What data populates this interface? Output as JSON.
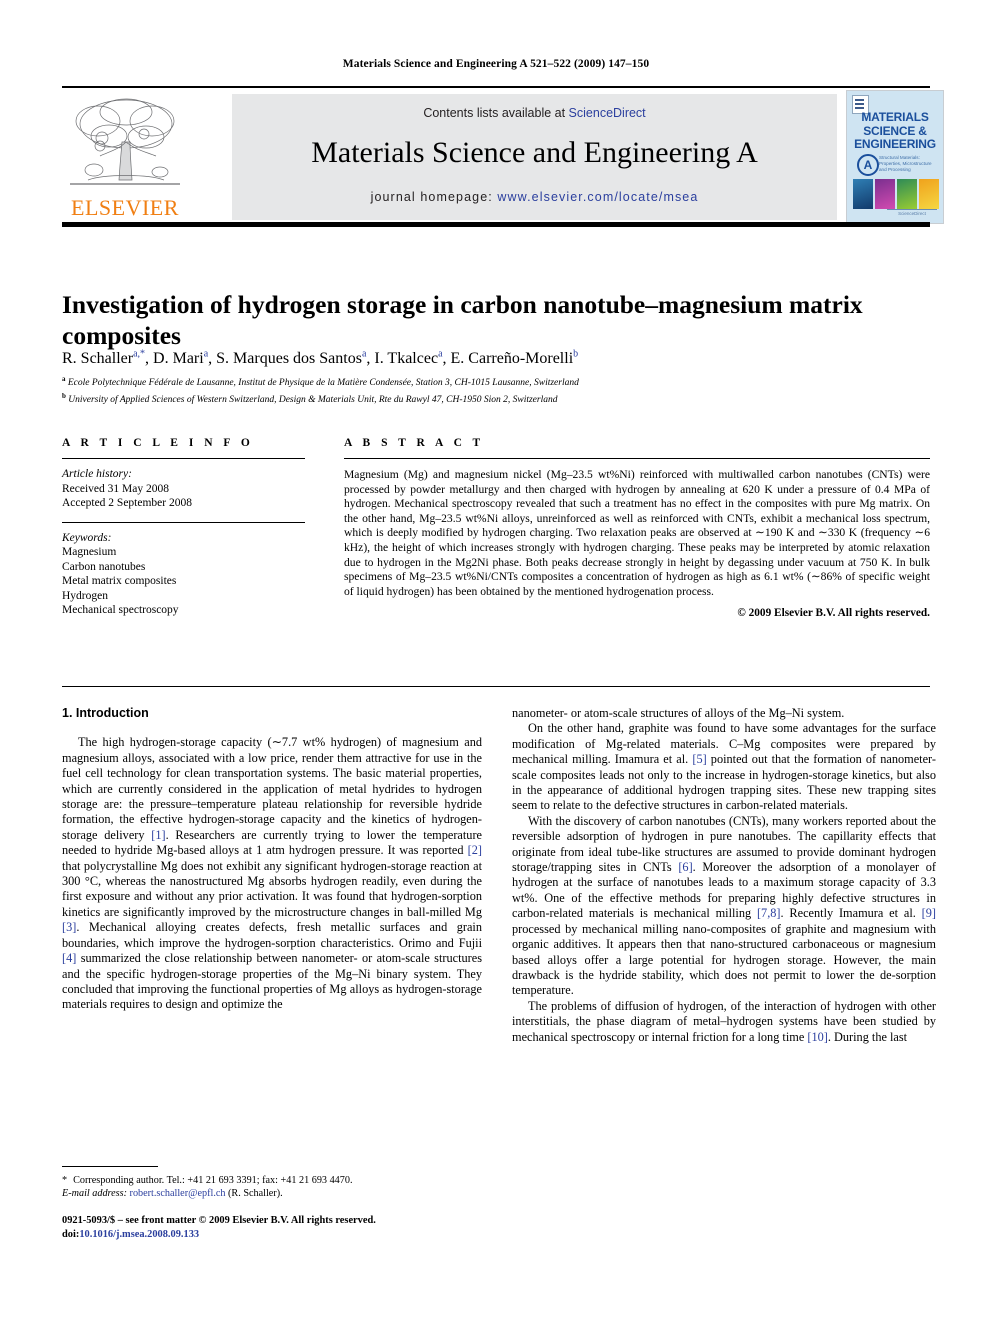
{
  "running_head": "Materials Science and Engineering A 521–522 (2009) 147–150",
  "masthead": {
    "contents_prefix": "Contents lists available at ",
    "sciencedirect": "ScienceDirect",
    "journal_title": "Materials Science and Engineering A",
    "homepage_prefix": "journal homepage: ",
    "homepage_url": "www.elsevier.com/locate/msea",
    "publisher": "ELSEVIER",
    "publisher_icon": "elsevier-tree-icon",
    "cover": {
      "title_line1": "MATERIALS",
      "title_line2": "SCIENCE &",
      "title_line3": "ENGINEERING",
      "badge": "A",
      "subtitle": "Structural Materials: Properties, Microstructure and Processing",
      "footer": "ScienceDirect",
      "background": "#cfe4f2",
      "title_color": "#1b4f9c"
    },
    "link_color": "#2b3f9e",
    "elsevier_orange": "#F07F13"
  },
  "article": {
    "title": "Investigation of hydrogen storage in carbon nanotube–magnesium matrix composites",
    "authors": "R. Schaller, D. Mari, S. Marques dos Santos, I. Tkalcec, E. Carreño-Morelli",
    "affiliation_a": "Ecole Polytechnique Fédérale de Lausanne, Institut de Physique de la Matière Condensée, Station 3, CH-1015 Lausanne, Switzerland",
    "affiliation_b": "University of Applied Sciences of Western Switzerland, Design & Materials Unit, Rte du Rawyl 47, CH-1950 Sion 2, Switzerland"
  },
  "article_info": {
    "heading": "A R T I C L E    I N F O",
    "history_label": "Article history:",
    "received": "Received 31 May 2008",
    "accepted": "Accepted 2 September 2008",
    "keywords_label": "Keywords:",
    "keywords": [
      "Magnesium",
      "Carbon nanotubes",
      "Metal matrix composites",
      "Hydrogen",
      "Mechanical spectroscopy"
    ]
  },
  "abstract": {
    "heading": "A B S T R A C T",
    "text": "Magnesium (Mg) and magnesium nickel (Mg–23.5 wt%Ni) reinforced with multiwalled carbon nanotubes (CNTs) were processed by powder metallurgy and then charged with hydrogen by annealing at 620 K under a pressure of 0.4 MPa of hydrogen. Mechanical spectroscopy revealed that such a treatment has no effect in the composites with pure Mg matrix. On the other hand, Mg–23.5 wt%Ni alloys, unreinforced as well as reinforced with CNTs, exhibit a mechanical loss spectrum, which is deeply modified by hydrogen charging. Two relaxation peaks are observed at ∼190 K and ∼330 K (frequency ∼6 kHz), the height of which increases strongly with hydrogen charging. These peaks may be interpreted by atomic relaxation due to hydrogen in the Mg2Ni phase. Both peaks decrease strongly in height by degassing under vacuum at 750 K. In bulk specimens of Mg–23.5 wt%Ni/CNTs composites a concentration of hydrogen as high as 6.1 wt% (∼86% of specific weight of liquid hydrogen) has been obtained by the mentioned hydrogenation process.",
    "copyright": "© 2009 Elsevier B.V. All rights reserved."
  },
  "body": {
    "section_number_title": "1.  Introduction",
    "left_paragraph_1_a": "The high hydrogen-storage capacity (∼7.7 wt% hydrogen) of magnesium and magnesium alloys, associated with a low price, render them attractive for use in the fuel cell technology for clean transportation systems. The basic material properties, which are currently considered in the application of metal hydrides to hydrogen storage are: the pressure–temperature plateau relationship for reversible hydride formation, the effective hydrogen-storage capacity and the kinetics of hydrogen-storage delivery ",
    "ref_1": "[1]",
    "left_paragraph_1_b": ". Researchers are currently trying to lower the temperature needed to hydride Mg-based alloys at 1 atm hydrogen pressure. It was reported ",
    "ref_2": "[2]",
    "left_paragraph_1_c": " that polycrystalline Mg does not exhibit any significant hydrogen-storage reaction at 300 °C, whereas the nanostructured Mg absorbs hydrogen readily, even during the first exposure and without any prior activation. It was found that hydrogen-sorption kinetics are significantly improved by the microstructure changes in ball-milled Mg ",
    "ref_3": "[3]",
    "left_paragraph_1_d": ". Mechanical alloying creates defects, fresh metallic surfaces and grain boundaries, which improve the hydrogen-sorption characteristics. Orimo and Fujii ",
    "ref_4": "[4]",
    "left_paragraph_1_e": " summarized the close relationship between nanometer- or atom-scale structures and the specific hydrogen-storage properties of the Mg–Ni binary system. They concluded that improving the functional properties of Mg alloys as hydrogen-storage materials requires to design and optimize the",
    "right_paragraph_1": "nanometer- or atom-scale structures of alloys of the Mg–Ni system.",
    "right_paragraph_2_a": "On the other hand, graphite was found to have some advantages for the surface modification of Mg-related materials. C–Mg composites were prepared by mechanical milling. Imamura et al. ",
    "ref_5": "[5]",
    "right_paragraph_2_b": " pointed out that the formation of nanometer-scale composites leads not only to the increase in hydrogen-storage kinetics, but also in the appearance of additional hydrogen trapping sites. These new trapping sites seem to relate to the defective structures in carbon-related materials.",
    "right_paragraph_3_a": "With the discovery of carbon nanotubes (CNTs), many workers reported about the reversible adsorption of hydrogen in pure nanotubes. The capillarity effects that originate from ideal tube-like structures are assumed to provide dominant hydrogen storage/trapping sites in CNTs ",
    "ref_6": "[6]",
    "right_paragraph_3_b": ". Moreover the adsorption of a monolayer of hydrogen at the surface of nanotubes leads to a maximum storage capacity of 3.3 wt%. One of the effective methods for preparing highly defective structures in carbon-related materials is mechanical milling ",
    "ref_78": "[7,8]",
    "right_paragraph_3_c": ". Recently Imamura et al. ",
    "ref_9": "[9]",
    "right_paragraph_3_d": " processed by mechanical milling nano-composites of graphite and magnesium with organic additives. It appears then that nano-structured carbonaceous or magnesium based alloys offer a large potential for hydrogen storage. However, the main drawback is the hydride stability, which does not permit to lower the de-sorption temperature.",
    "right_paragraph_4_a": "The problems of diffusion of hydrogen, of the interaction of hydrogen with other interstitials, the phase diagram of metal–hydrogen systems have been studied by mechanical spectroscopy or internal friction for a long time ",
    "ref_10": "[10]",
    "right_paragraph_4_b": ". During the last"
  },
  "footnote": {
    "star": "*",
    "text": "Corresponding author. Tel.: +41 21 693 3391; fax: +41 21 693 4470.",
    "email_label": "E-mail address:",
    "email": "robert.schaller@epfl.ch",
    "email_suffix": "(R. Schaller)."
  },
  "imprint": {
    "line1": "0921-5093/$ – see front matter © 2009 Elsevier B.V. All rights reserved.",
    "doi_label": "doi:",
    "doi": "10.1016/j.msea.2008.09.133"
  }
}
